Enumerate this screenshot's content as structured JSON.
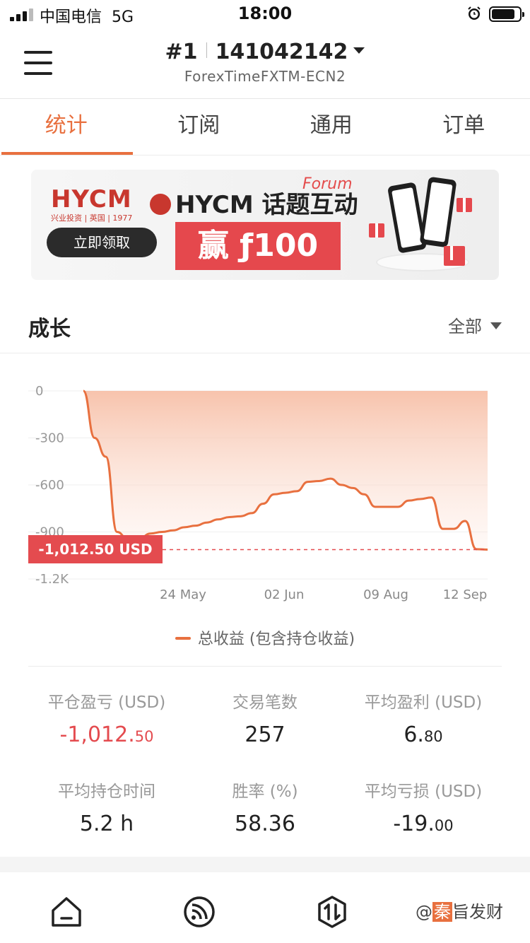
{
  "status_bar": {
    "carrier": "中国电信",
    "network": "5G",
    "time": "18:00"
  },
  "header": {
    "rank": "#1",
    "account": "141042142",
    "server": "ForexTimeFXTM-ECN2"
  },
  "tabs": [
    {
      "label": "统计",
      "active": true
    },
    {
      "label": "订阅",
      "active": false
    },
    {
      "label": "通用",
      "active": false
    },
    {
      "label": "订单",
      "active": false
    }
  ],
  "banner": {
    "logo": "HYCM",
    "logo_sub": "兴业投资 | 英国 |",
    "logo_badge": "1977",
    "cta": "立即领取",
    "headline": "HYCM 话题互动",
    "script": "Forum",
    "prize": "赢 ƒ100"
  },
  "growth": {
    "title": "成长",
    "filter": "全部"
  },
  "chart_data": {
    "type": "area",
    "y_ticks": [
      "0",
      "-300",
      "-600",
      "-900",
      "-1.2K"
    ],
    "ylim": [
      -1200,
      0
    ],
    "x_ticks": [
      "24 May",
      "02 Jun",
      "09 Aug",
      "12 Sep"
    ],
    "series": [
      {
        "name": "总收益 (包含持仓收益)",
        "values": [
          0,
          -300,
          -420,
          -900,
          -950,
          -940,
          -910,
          -900,
          -890,
          -870,
          -860,
          -840,
          -820,
          -805,
          -800,
          -780,
          -720,
          -660,
          -650,
          -640,
          -580,
          -575,
          -560,
          -600,
          -620,
          -660,
          -740,
          -740,
          -740,
          -700,
          -690,
          -680,
          -880,
          -880,
          -830,
          -1010,
          -1012.5
        ]
      }
    ],
    "current_label": "-1,012.50 USD",
    "current_value": -1012.5,
    "colors": {
      "line": "#e8703f",
      "fill": "#f9d4c2",
      "marker": "#e44b4f"
    }
  },
  "legend": {
    "label": "总收益 (包含持仓收益)"
  },
  "stats": [
    {
      "label": "平仓盈亏 (USD)",
      "value_main": "-1,012.",
      "value_small": "50",
      "negative": true
    },
    {
      "label": "交易笔数",
      "value_main": "257",
      "value_small": "",
      "negative": false
    },
    {
      "label": "平均盈利 (USD)",
      "value_main": "6.",
      "value_small": "80",
      "negative": false
    },
    {
      "label": "平均持仓时间",
      "value_main": "5.2 h",
      "value_small": "",
      "negative": false
    },
    {
      "label": "胜率 (%)",
      "value_main": "58.36",
      "value_small": "",
      "negative": false
    },
    {
      "label": "平均亏损 (USD)",
      "value_main": "-19.",
      "value_small": "00",
      "negative": false
    }
  ],
  "bottom_nav": {
    "items": [
      "home-icon",
      "feed-icon",
      "trade-icon"
    ],
    "watermark_prefix": "@",
    "watermark_highlight": "秦",
    "watermark_rest": "旨发财"
  }
}
